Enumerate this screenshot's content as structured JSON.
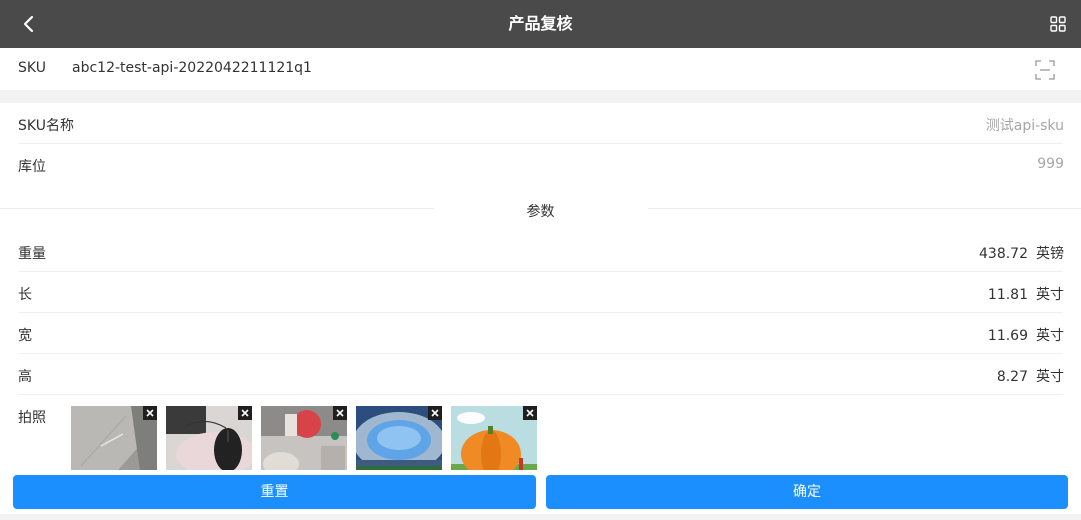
{
  "header": {
    "title": "产品复核",
    "back_icon": "chevron-left-icon",
    "grid_icon": "grid-icon"
  },
  "sku": {
    "label": "SKU",
    "value": "abc12-test-api-2022042211121q1",
    "scan_icon": "scan-icon"
  },
  "info": [
    {
      "label": "SKU名称",
      "value": "测试api-sku"
    },
    {
      "label": "库位",
      "value": "999"
    }
  ],
  "params": {
    "title": "参数",
    "rows": [
      {
        "label": "重量",
        "value": "438.72",
        "unit": "英镑"
      },
      {
        "label": "长",
        "value": "11.81",
        "unit": "英寸"
      },
      {
        "label": "宽",
        "value": "11.69",
        "unit": "英寸"
      },
      {
        "label": "高",
        "value": "8.27",
        "unit": "英寸"
      }
    ]
  },
  "photos": {
    "label": "拍照",
    "items": [
      {
        "subject": "floor-photo"
      },
      {
        "subject": "mouse-photo"
      },
      {
        "subject": "desk-photo"
      },
      {
        "subject": "stadium-photo"
      },
      {
        "subject": "pumpkin-photo"
      }
    ]
  },
  "actions": {
    "reset": "重置",
    "confirm": "确定"
  },
  "colors": {
    "header_bg": "#4a4a4a",
    "primary": "#1c8fff",
    "muted_text": "#a6a6a6"
  }
}
